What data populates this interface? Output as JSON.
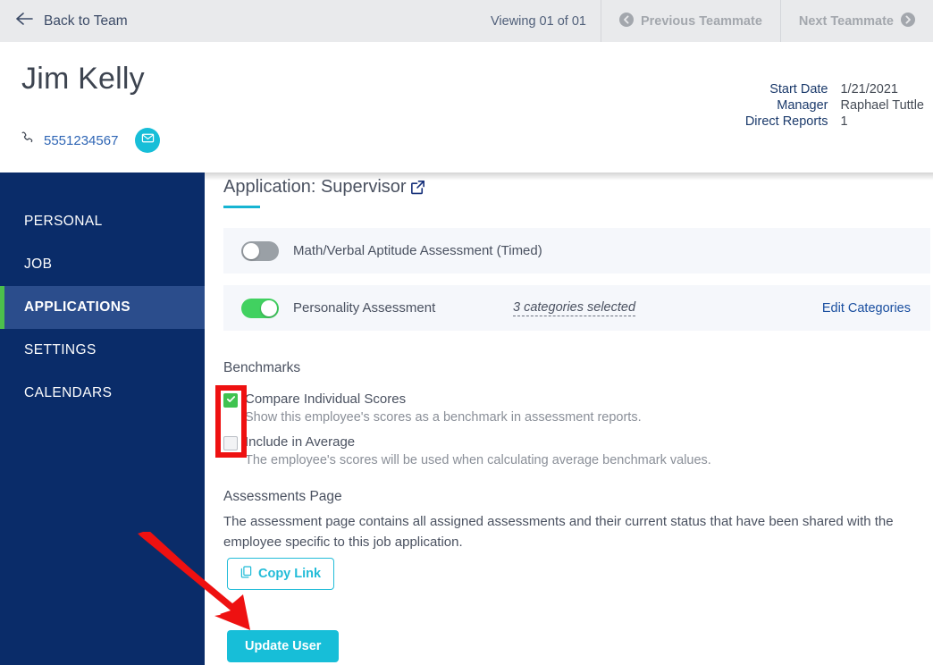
{
  "topbar": {
    "back_label": "Back to Team",
    "back_icon": "arrow-left-icon",
    "viewing_text": "Viewing 01 of 01",
    "previous_label": "Previous Teammate",
    "previous_icon": "chevron-circle-left-icon",
    "next_label": "Next Teammate",
    "next_icon": "chevron-circle-right-icon"
  },
  "person": {
    "name": "Jim Kelly",
    "phone": "5551234567",
    "phone_icon": "phone-icon",
    "email_icon": "envelope-icon",
    "meta": [
      {
        "label": "Start Date",
        "value": "1/21/2021"
      },
      {
        "label": "Manager",
        "value": "Raphael Tuttle"
      },
      {
        "label": "Direct Reports",
        "value": "1"
      }
    ]
  },
  "sidebar": {
    "items": [
      {
        "label": "PERSONAL",
        "active": false
      },
      {
        "label": "JOB",
        "active": false
      },
      {
        "label": "APPLICATIONS",
        "active": true
      },
      {
        "label": "SETTINGS",
        "active": false
      },
      {
        "label": "CALENDARS",
        "active": false
      }
    ]
  },
  "main": {
    "section_title": "Application: Supervisor",
    "section_title_icon": "external-link-icon",
    "assessments": [
      {
        "label": "Math/Verbal Aptitude Assessment (Timed)",
        "toggle_state": "off",
        "categories_text": "",
        "edit_label": ""
      },
      {
        "label": "Personality Assessment",
        "toggle_state": "on",
        "categories_text": "3 categories selected",
        "edit_label": "Edit Categories"
      }
    ],
    "benchmarks": {
      "heading": "Benchmarks",
      "options": [
        {
          "title": "Compare Individual Scores",
          "description": "Show this employee's scores as a benchmark in assessment reports.",
          "checked": true
        },
        {
          "title": "Include in Average",
          "description": "The employee's scores will be used when calculating average benchmark values.",
          "checked": false
        }
      ]
    },
    "assessments_page": {
      "heading": "Assessments Page",
      "description": "The assessment page contains all assigned assessments and their current status that have been shared with the employee specific to this job application.",
      "copy_link_label": "Copy Link",
      "copy_link_icon": "copy-icon"
    },
    "update_button_label": "Update User"
  },
  "colors": {
    "sidebar_bg": "#0a2c69",
    "sidebar_active_bg": "#2b4d8c",
    "sidebar_active_accent": "#4cc04c",
    "accent_cyan": "#17bed8",
    "toggle_on": "#41d160",
    "toggle_off": "#9aa0a6",
    "checkbox_checked": "#3fc350",
    "annotation_red": "#ee1111",
    "link_blue": "#1a4fa0",
    "topbar_bg": "#e9eaec"
  }
}
